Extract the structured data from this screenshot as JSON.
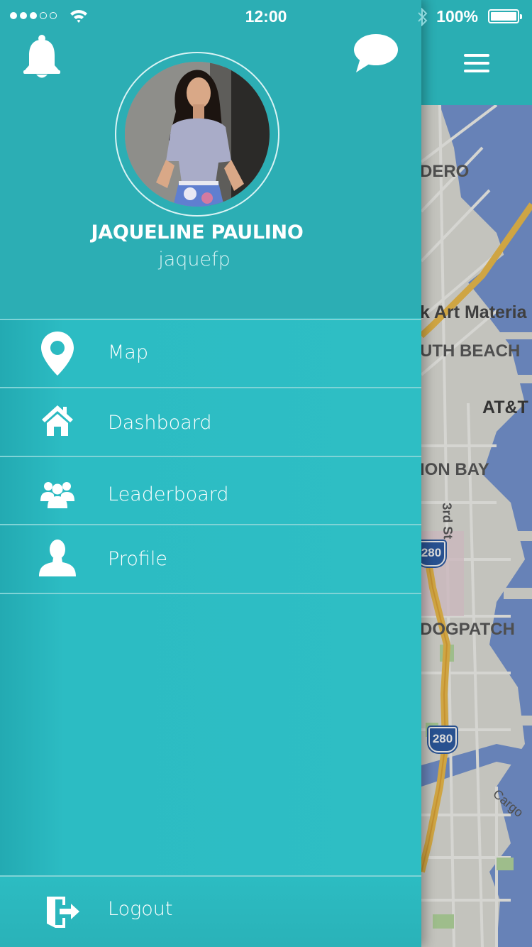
{
  "status_bar": {
    "clock": "12:00",
    "battery": "100%",
    "signal_dots_filled": 3,
    "signal_dots_total": 5,
    "icons": [
      "wifi-icon",
      "bluetooth-icon",
      "battery-icon"
    ]
  },
  "drawer": {
    "user": {
      "name": "JAQUELINE PAULINO",
      "handle": "jaquefp"
    },
    "header_icons": [
      "bell-icon",
      "chat-bubble-icon"
    ],
    "menu": [
      {
        "label": "Map",
        "icon": "map-pin-icon"
      },
      {
        "label": "Dashboard",
        "icon": "home-icon"
      },
      {
        "label": "Leaderboard",
        "icon": "group-icon"
      },
      {
        "label": "Profile",
        "icon": "user-icon"
      }
    ],
    "logout": {
      "label": "Logout",
      "icon": "exit-door-icon"
    }
  },
  "app_header": {
    "menu_icon": "hamburger-icon"
  },
  "map": {
    "labels": [
      "DERO",
      "k Art Materia",
      "UTH BEACH",
      "AT&T",
      "ION BAY",
      "3rd St",
      "DOGPATCH",
      "Cargo"
    ],
    "highway_shields": [
      "280",
      "280"
    ]
  },
  "colors": {
    "drawer": "#2ebec4",
    "header": "#2caeb4",
    "divider": "#7fd3d6",
    "water": "#7898d6",
    "land": "#e3e3dd"
  }
}
